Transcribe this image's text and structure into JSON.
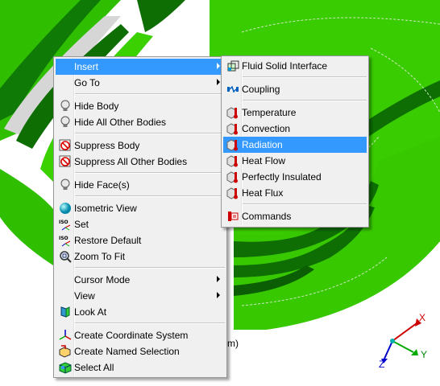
{
  "context_menu": {
    "items": [
      {
        "label": "Insert",
        "icon": "none",
        "submenu": true,
        "highlighted": true
      },
      {
        "label": "Go To",
        "icon": "none",
        "submenu": true
      },
      {
        "label": "Hide Body",
        "icon": "lightbulb-icon"
      },
      {
        "label": "Hide All Other Bodies",
        "icon": "lightbulb-icon"
      },
      {
        "label": "Suppress Body",
        "icon": "suppress-icon"
      },
      {
        "label": "Suppress All Other Bodies",
        "icon": "suppress-icon"
      },
      {
        "label": "Hide Face(s)",
        "icon": "lightbulb-icon"
      },
      {
        "label": "Isometric View",
        "icon": "sphere-icon"
      },
      {
        "label": "Set",
        "icon": "iso-set-icon"
      },
      {
        "label": "Restore Default",
        "icon": "iso-restore-icon"
      },
      {
        "label": "Zoom To Fit",
        "icon": "zoom-fit-icon"
      },
      {
        "label": "Cursor Mode",
        "icon": "none",
        "submenu": true
      },
      {
        "label": "View",
        "icon": "none",
        "submenu": true
      },
      {
        "label": "Look At",
        "icon": "look-at-icon"
      },
      {
        "label": "Create Coordinate System",
        "icon": "coordinate-system-icon"
      },
      {
        "label": "Create Named Selection",
        "icon": "named-selection-icon"
      },
      {
        "label": "Select All",
        "icon": "select-all-icon"
      }
    ]
  },
  "insert_submenu": {
    "items": [
      {
        "label": "Fluid Solid Interface",
        "icon": "fluid-solid-interface-icon"
      },
      {
        "label": "Coupling",
        "icon": "coupling-icon"
      },
      {
        "label": "Temperature",
        "icon": "temperature-icon"
      },
      {
        "label": "Convection",
        "icon": "convection-icon"
      },
      {
        "label": "Radiation",
        "icon": "radiation-icon",
        "highlighted": true
      },
      {
        "label": "Heat Flow",
        "icon": "heat-flow-icon"
      },
      {
        "label": "Perfectly Insulated",
        "icon": "perfectly-insulated-icon"
      },
      {
        "label": "Heat Flux",
        "icon": "heat-flux-icon"
      },
      {
        "label": "Commands",
        "icon": "commands-icon"
      }
    ]
  },
  "viewport": {
    "scale_unit_fragment": "m)",
    "triad": {
      "x_label": "X",
      "y_label": "Y",
      "z_label": "Z"
    }
  },
  "colors": {
    "model_green": "#33cc00",
    "model_dark_green": "#0f7a05",
    "highlight": "#3399ff",
    "menu_bg": "#f0f0f0"
  }
}
